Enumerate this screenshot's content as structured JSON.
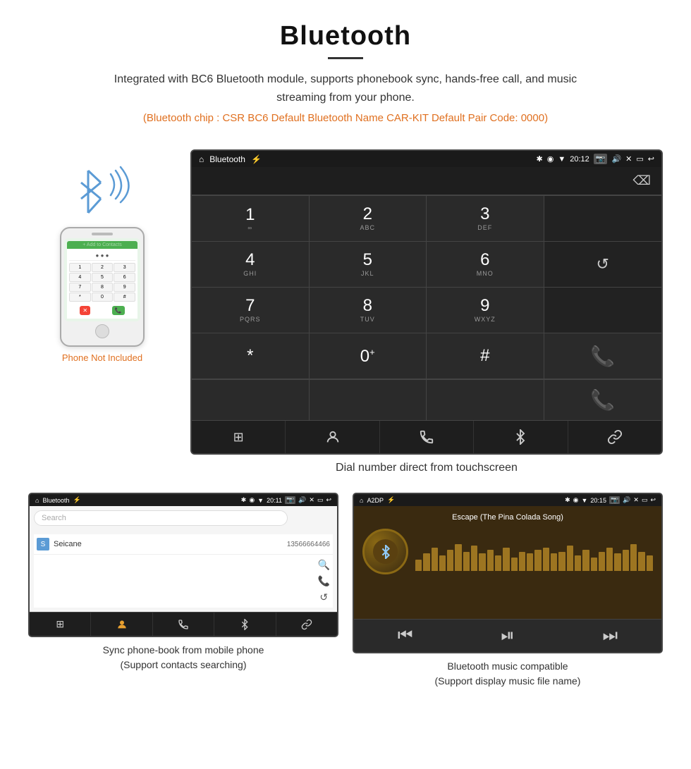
{
  "header": {
    "title": "Bluetooth",
    "description": "Integrated with BC6 Bluetooth module, supports phonebook sync, hands-free call, and music streaming from your phone.",
    "info_line": "(Bluetooth chip : CSR BC6    Default Bluetooth Name CAR-KIT    Default Pair Code: 0000)"
  },
  "big_screen": {
    "status_bar": {
      "home_icon": "⌂",
      "app_name": "Bluetooth",
      "usb_icon": "⚡",
      "bt_icon": "✱",
      "location_icon": "◉",
      "wifi_icon": "▼",
      "time": "20:12",
      "camera_icon": "📷",
      "volume_icon": "🔊",
      "close_icon": "✕",
      "window_icon": "▭",
      "back_icon": "↩"
    },
    "keypad": {
      "keys": [
        {
          "number": "1",
          "letters": ""
        },
        {
          "number": "2",
          "letters": "ABC"
        },
        {
          "number": "3",
          "letters": "DEF"
        },
        {
          "number": "",
          "letters": ""
        },
        {
          "number": "4",
          "letters": "GHI"
        },
        {
          "number": "5",
          "letters": "JKL"
        },
        {
          "number": "6",
          "letters": "MNO"
        },
        {
          "number": "",
          "letters": ""
        },
        {
          "number": "7",
          "letters": "PQRS"
        },
        {
          "number": "8",
          "letters": "TUV"
        },
        {
          "number": "9",
          "letters": "WXYZ"
        },
        {
          "number": "",
          "letters": ""
        },
        {
          "number": "*",
          "letters": ""
        },
        {
          "number": "0",
          "letters": "+"
        },
        {
          "number": "#",
          "letters": ""
        },
        {
          "number": "",
          "letters": ""
        }
      ]
    },
    "toolbar": {
      "keypad_icon": "⊞",
      "contact_icon": "👤",
      "call_icon": "📞",
      "bt_icon": "✱",
      "link_icon": "🔗"
    },
    "caption": "Dial number direct from touchscreen"
  },
  "phone_side": {
    "not_included": "Phone Not Included"
  },
  "phonebook_screen": {
    "status_bar": {
      "home": "⌂",
      "app": "Bluetooth",
      "time": "20:11",
      "usb": "⚡"
    },
    "search_placeholder": "Search",
    "contacts": [
      {
        "letter": "S",
        "name": "Seicane",
        "number": "13566664466"
      }
    ],
    "toolbar": {
      "keypad": "⊞",
      "contact": "👤",
      "call": "📞",
      "bt": "✱",
      "link": "🔗"
    },
    "caption": "Sync phone-book from mobile phone\n(Support contacts searching)"
  },
  "music_screen": {
    "status_bar": {
      "home": "⌂",
      "app": "A2DP",
      "time": "20:15"
    },
    "song_title": "Escape (The Pina Colada Song)",
    "eq_bars": [
      30,
      45,
      60,
      40,
      55,
      70,
      50,
      65,
      45,
      55,
      40,
      60,
      35,
      50,
      45,
      55,
      60,
      45,
      50,
      65,
      40,
      55,
      35,
      50,
      60,
      45,
      55,
      70,
      50,
      40
    ],
    "controls": {
      "prev": "⏮",
      "play_pause": "⏯",
      "next": "⏭"
    },
    "caption": "Bluetooth music compatible\n(Support display music file name)"
  }
}
